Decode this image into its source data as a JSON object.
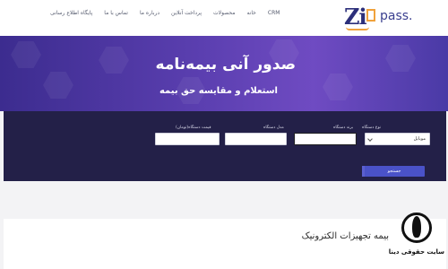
{
  "nav": {
    "links": [
      "پایگاه اطلاع رسانی",
      "تماس با ما",
      "درباره ما",
      "پرداخت آنلاین",
      "محصولات",
      "خانه",
      "CRM"
    ]
  },
  "logo": {
    "part1": "Zi",
    "part2": "pass."
  },
  "hero": {
    "title": "صدور آنی بیمه‌نامه",
    "subtitle": "استعلام و مقایسه حق بیمه"
  },
  "form": {
    "device_type_label": "نوع دستگاه",
    "device_type_value": "موبایل",
    "brand_label": "برند دستگاه",
    "brand_value": "",
    "model_label": "مدل دستگاه",
    "model_value": "",
    "price_label": "قیمت دستگاه(تومان)",
    "price_value": "",
    "search_label": "جستجو"
  },
  "article": {
    "title": "بیمه تجهیزات الکترونیک"
  },
  "badge": {
    "text": "سایت حقوقی دینا"
  },
  "colors": {
    "hero_start": "#3c2c8f",
    "hero_end": "#6f4bc2",
    "panel": "#232048",
    "button": "#4a52c8",
    "logo_accent": "#f0a23c"
  }
}
